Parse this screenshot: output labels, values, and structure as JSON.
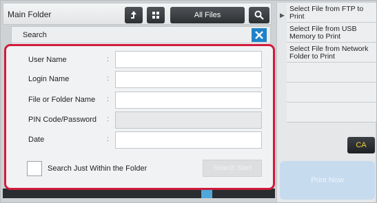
{
  "topbar": {
    "title": "Main Folder",
    "all_files_label": "All Files"
  },
  "dialog": {
    "title": "Search"
  },
  "form": {
    "fields": [
      {
        "label": "User Name",
        "value": ""
      },
      {
        "label": "Login Name",
        "value": ""
      },
      {
        "label": "File or Folder Name",
        "value": ""
      },
      {
        "label": "PIN Code/Password",
        "value": ""
      },
      {
        "label": "Date",
        "value": ""
      }
    ],
    "colon": ":",
    "checkbox_label": "Search Just Within the Folder",
    "search_start_label": "Search Start"
  },
  "right_panel": {
    "items": [
      "Select File from FTP to Print",
      "Select File from USB Memory to Print",
      "Select File from Network Folder to Print"
    ],
    "ca_label": "CA",
    "print_now_label": "Print Now"
  },
  "colors": {
    "highlight": "#d11a3a",
    "close_button": "#1e82c8",
    "ca_text": "#f0d23c"
  }
}
